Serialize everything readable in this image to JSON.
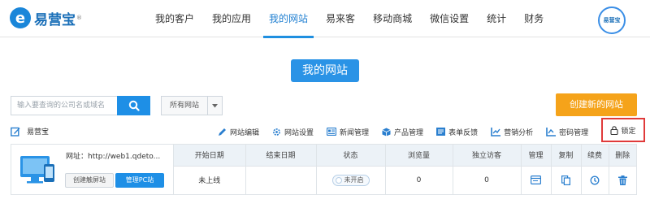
{
  "brand": {
    "logo_mark": "e",
    "name": "易营宝",
    "reg": "®"
  },
  "nav": {
    "items": [
      {
        "label": "我的客户"
      },
      {
        "label": "我的应用"
      },
      {
        "label": "我的网站",
        "active": true
      },
      {
        "label": "易来客"
      },
      {
        "label": "移动商城"
      },
      {
        "label": "微信设置"
      },
      {
        "label": "统计"
      },
      {
        "label": "财务"
      }
    ]
  },
  "user": {
    "avatar_text": "易营宝"
  },
  "page_title": "我的网站",
  "search": {
    "placeholder": "输入要查询的公司名或域名",
    "icon": "search-icon"
  },
  "filter": {
    "selected": "所有网站"
  },
  "create_button": "创建新的网站",
  "site": {
    "name": "易营宝",
    "url_text": "网址：http://web1.qdeto...",
    "mobile_button": "创建触屏站",
    "pc_button": "管理PC站"
  },
  "toolbar": {
    "actions": [
      {
        "label": "网站编辑",
        "icon": "pencil-icon"
      },
      {
        "label": "网站设置",
        "icon": "gear-icon"
      },
      {
        "label": "新闻管理",
        "icon": "news-icon"
      },
      {
        "label": "产品管理",
        "icon": "box-icon"
      },
      {
        "label": "表单反馈",
        "icon": "form-icon"
      },
      {
        "label": "营销分析",
        "icon": "chart-icon"
      },
      {
        "label": "密码管理",
        "icon": "password-icon"
      }
    ],
    "lock_label": "锁定"
  },
  "table": {
    "headers": [
      "开始日期",
      "结束日期",
      "状态",
      "浏览量",
      "独立访客",
      "管理",
      "复制",
      "续费",
      "删除"
    ],
    "row": {
      "start_date": "未上线",
      "end_date": "",
      "status": "未开启",
      "views": "0",
      "visitors": "0"
    }
  },
  "colors": {
    "primary": "#1e8fe6",
    "orange": "#f5a31a",
    "red": "#e23b3b",
    "header_bg": "#ecf2f7"
  }
}
